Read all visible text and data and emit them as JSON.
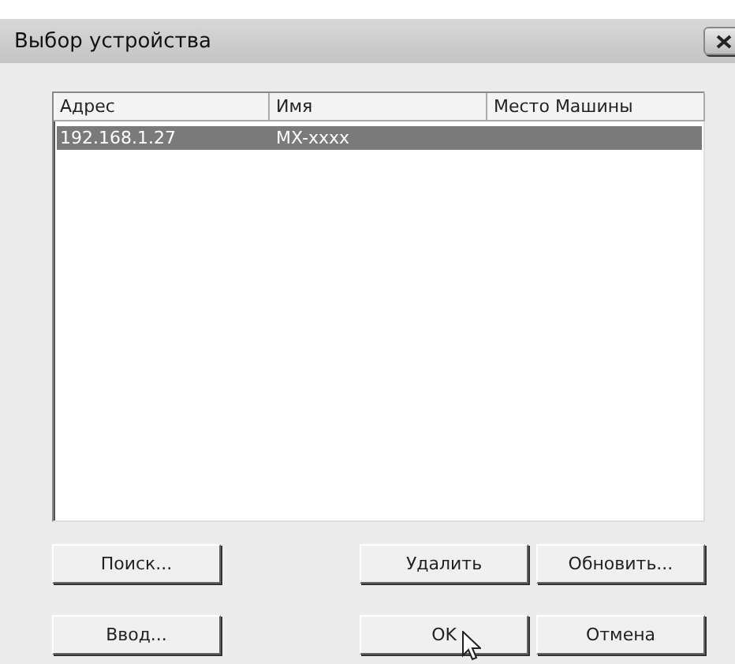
{
  "window": {
    "title": "Выбор устройства"
  },
  "table": {
    "columns": [
      "Адрес",
      "Имя",
      "Место Машины"
    ],
    "rows": [
      {
        "cells": [
          "192.168.1.27",
          "MX-xxxx",
          ""
        ],
        "selected": true
      }
    ]
  },
  "button_rows": [
    [
      "Поиск...",
      null,
      "Удалить",
      "Обновить..."
    ],
    [
      "Ввод...",
      null,
      "OK",
      "Отмена"
    ]
  ]
}
